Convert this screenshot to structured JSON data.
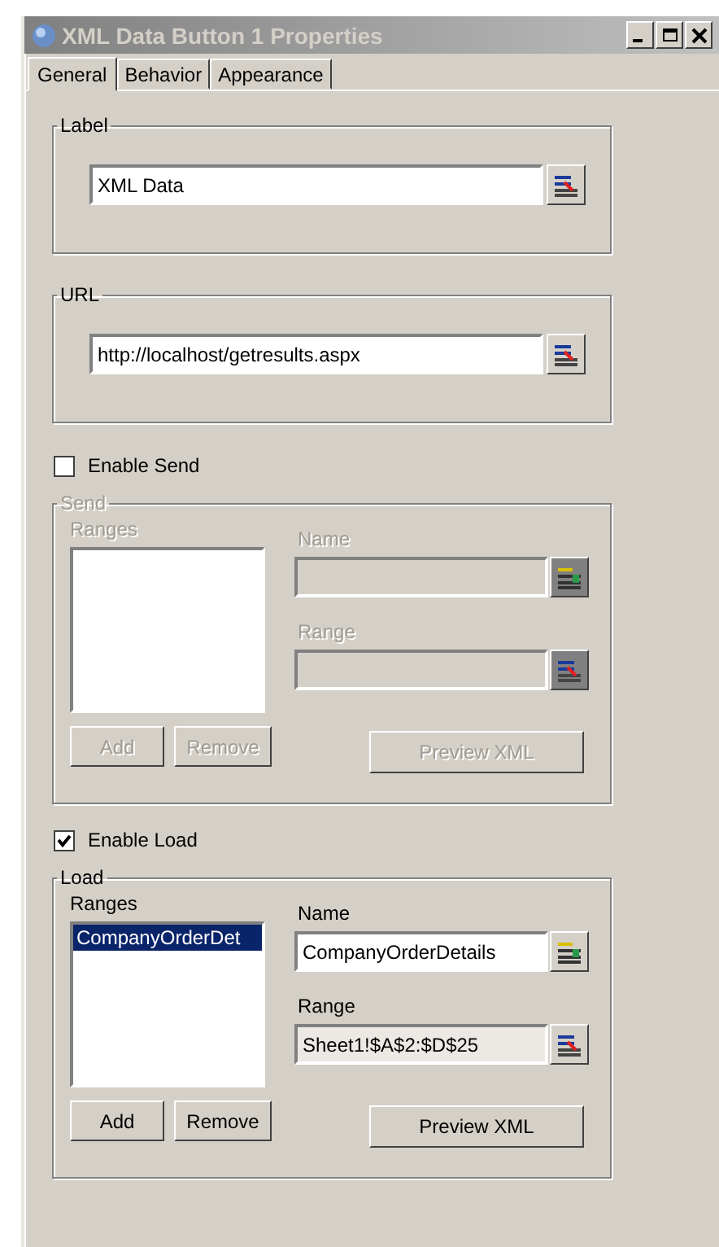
{
  "window": {
    "title": "XML Data Button 1 Properties"
  },
  "tabs": [
    {
      "label": "General",
      "selected": true
    },
    {
      "label": "Behavior",
      "selected": false
    },
    {
      "label": "Appearance",
      "selected": false
    }
  ],
  "fields": [
    {
      "title": "Label",
      "value": "XML Data"
    },
    {
      "title": "URL",
      "value": "http://localhost/getresults.aspx"
    }
  ],
  "sections": [
    {
      "checkbox": {
        "label": "Enable Send",
        "checked": false
      },
      "group": {
        "title": "Send",
        "disabled": true,
        "ranges_label": "Ranges",
        "name_label": "Name",
        "range_label": "Range",
        "buttons": [
          "Add",
          "Remove",
          "Preview XML"
        ]
      }
    },
    {
      "checkbox": {
        "label": "Enable Load",
        "checked": true
      },
      "group": {
        "title": "Load",
        "disabled": false,
        "ranges_label": "Ranges",
        "ranges": [
          {
            "text": "CompanyOrderDet",
            "selected": true
          }
        ],
        "name_label": "Name",
        "name_value": "CompanyOrderDetails",
        "range_label": "Range",
        "range_value": "Sheet1!$A$2:$D$25",
        "buttons": [
          "Add",
          "Remove",
          "Preview XML"
        ]
      }
    }
  ]
}
